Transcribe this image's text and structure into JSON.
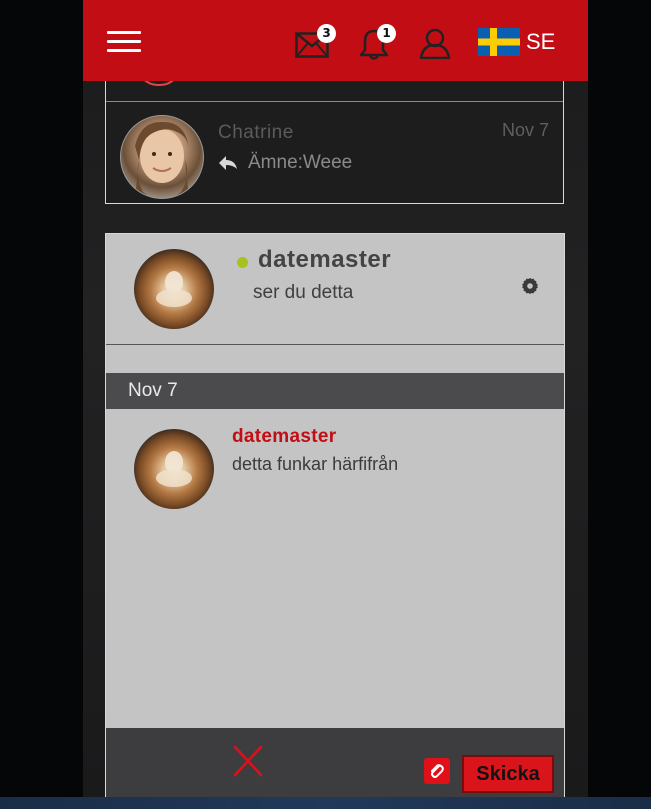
{
  "header": {
    "messages_badge": "3",
    "notifications_badge": "1",
    "language_code": "SE"
  },
  "conversations": [
    {
      "name": "Chatrine",
      "date": "Nov 7",
      "subject": "Ämne:Weee"
    }
  ],
  "chat": {
    "partner_name": "datemaster",
    "partner_status": "ser du detta",
    "online": true,
    "date_separator": "Nov 7",
    "messages": [
      {
        "sender": "datemaster",
        "text": "detta funkar härfifrån"
      }
    ],
    "send_label": "Skicka"
  },
  "colors": {
    "brand_red": "#c30d14",
    "online_green": "#a5c31c",
    "panel_gray": "#c4c4c4",
    "date_bar": "#4b4b4d"
  },
  "icons": [
    "menu-icon",
    "mail-icon",
    "bell-icon",
    "user-icon",
    "sweden-flag-icon",
    "reply-arrow-icon",
    "gear-icon",
    "close-icon",
    "attach-icon"
  ]
}
